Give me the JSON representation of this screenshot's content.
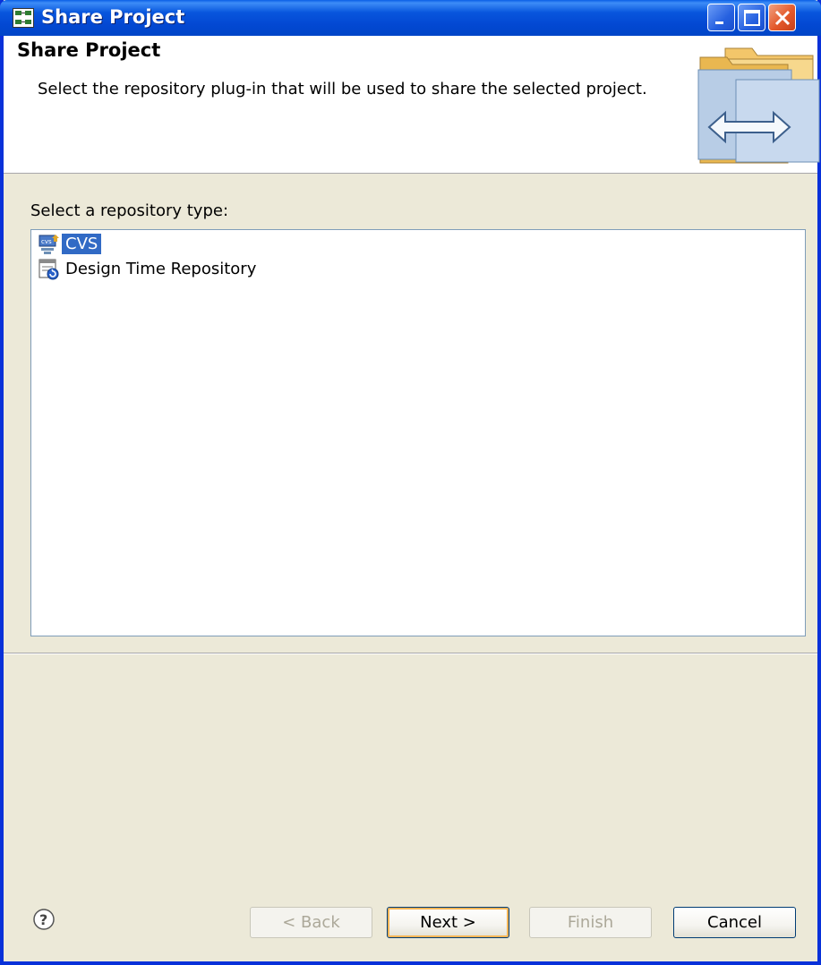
{
  "window": {
    "title": "Share Project",
    "app_icon": "share-project-icon",
    "controls": [
      "minimize-icon",
      "maximize-icon",
      "close-icon"
    ]
  },
  "banner": {
    "title": "Share Project",
    "description": "Select the repository plug-in that will be used to share the selected project.",
    "image": "share-folders-arrows-image"
  },
  "repository": {
    "label": "Select a repository type:",
    "items": [
      {
        "label": "CVS",
        "icon": "cvs-icon",
        "selected": true
      },
      {
        "label": "Design Time Repository",
        "icon": "design-time-repository-icon",
        "selected": false
      }
    ]
  },
  "footer": {
    "help_icon": "help-icon",
    "back_label": "< Back",
    "next_label": "Next >",
    "finish_label": "Finish",
    "cancel_label": "Cancel"
  },
  "colors": {
    "titlebar": "#0856dd",
    "selection": "#316ac5",
    "dialog_bg": "#ece9d8",
    "close_button": "#e3592b"
  }
}
